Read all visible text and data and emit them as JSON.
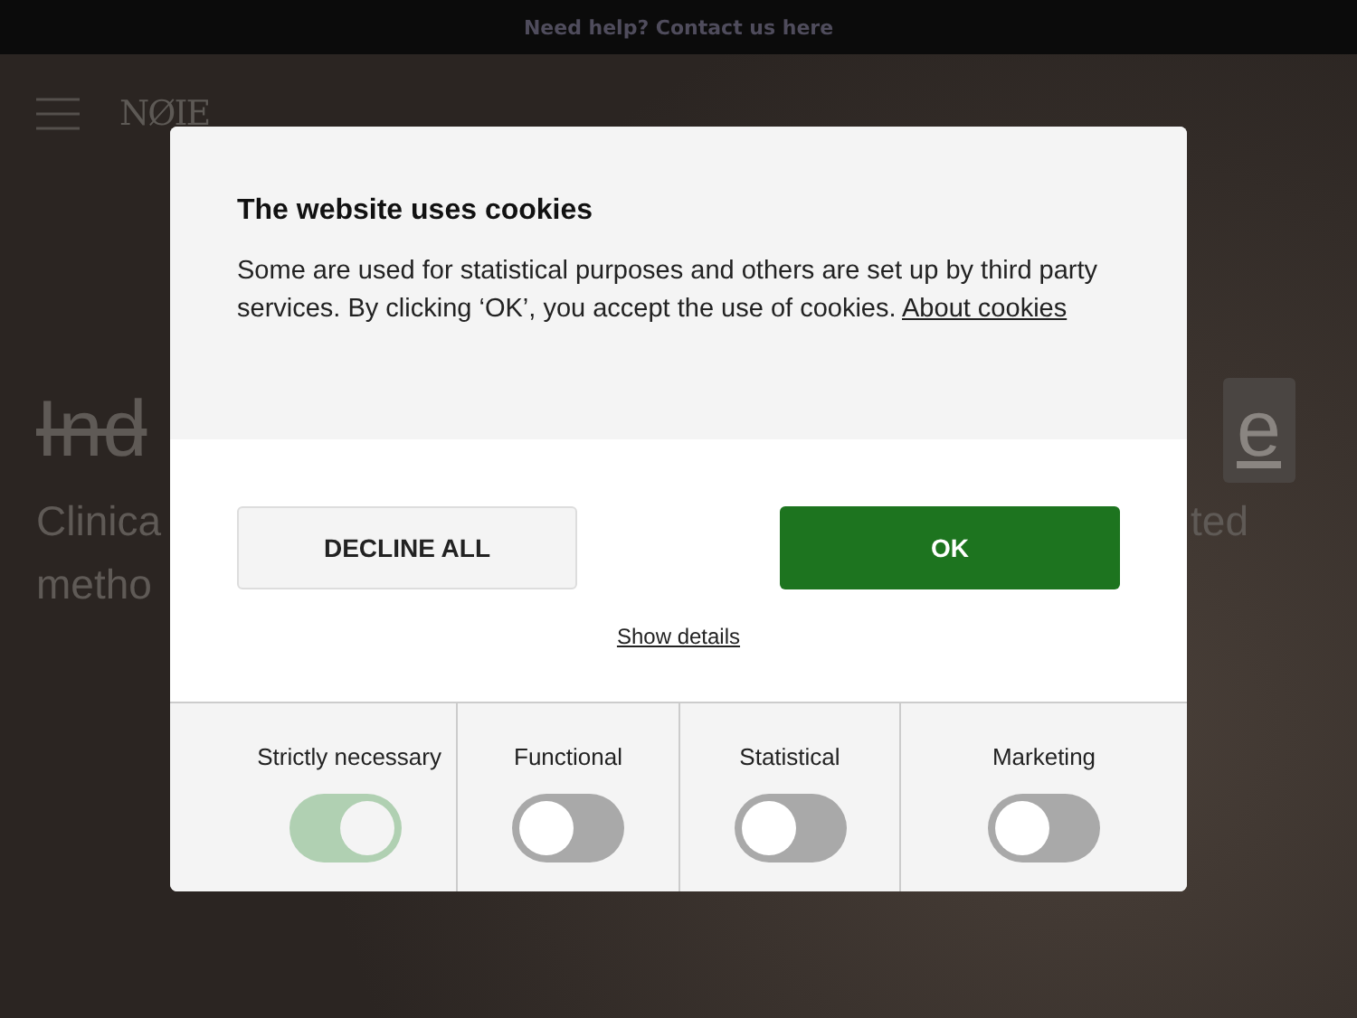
{
  "top_bar": {
    "text": "Need help? Contact us here"
  },
  "header": {
    "logo": "NØIE"
  },
  "hero": {
    "title_left": "Ind",
    "title_right": "e",
    "subtitle_lines": [
      {
        "left": "Clinica",
        "right": "ted"
      },
      {
        "left": "metho"
      }
    ]
  },
  "cookie_dialog": {
    "title": "The website uses cookies",
    "body": "Some are used for statistical purposes and others are set up by third party services. By clicking ‘OK’, you accept the use of cookies.",
    "link": "About cookies",
    "buttons": [
      {
        "label": "DECLINE ALL",
        "kind": "secondary"
      },
      {
        "label": "OK",
        "kind": "primary"
      }
    ],
    "details_link": "Show details",
    "categories": [
      {
        "label": "Strictly necessary",
        "on": true,
        "disabled": true
      },
      {
        "label": "Functional",
        "on": false,
        "disabled": false
      },
      {
        "label": "Statistical",
        "on": false,
        "disabled": false
      },
      {
        "label": "Marketing",
        "on": false,
        "disabled": false
      }
    ]
  }
}
